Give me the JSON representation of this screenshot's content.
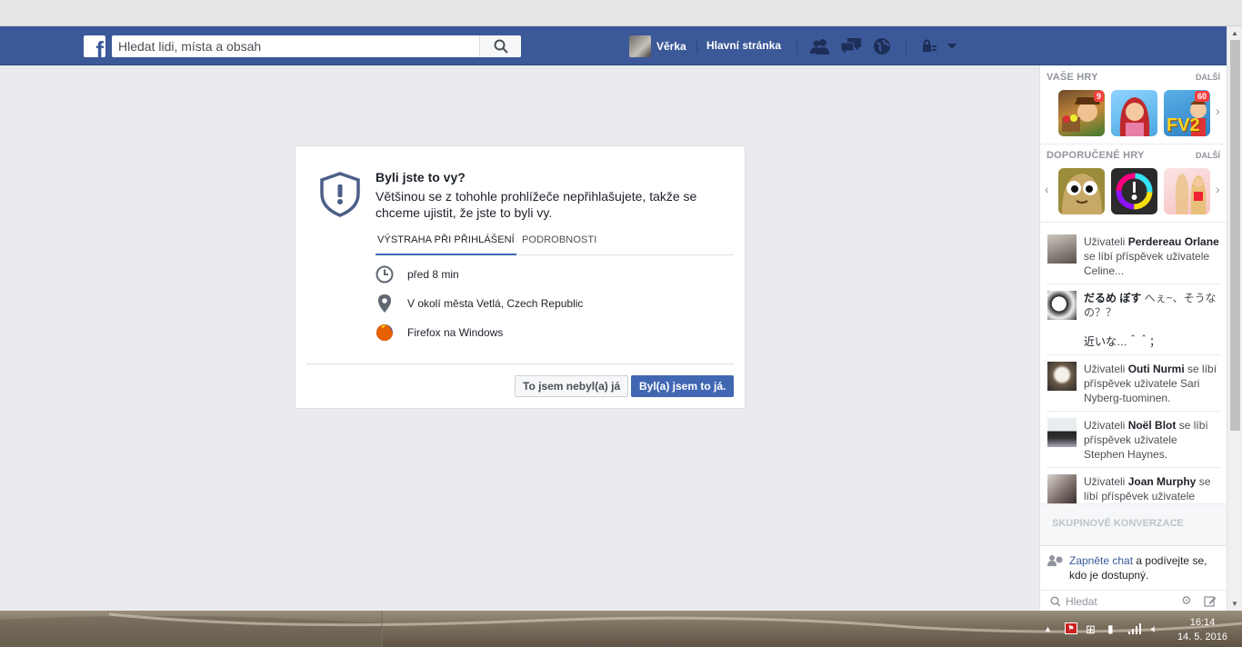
{
  "header": {
    "logo_letter": "f",
    "search_placeholder": "Hledat lidi, místa a obsah",
    "user_name": "Věrka",
    "home_label": "Hlavní stránka",
    "jewels": [
      "friend-requests-icon",
      "messages-icon",
      "notifications-icon",
      "privacy-lock-icon"
    ]
  },
  "alert": {
    "title": "Byli jste to vy?",
    "description": "Většinou se z tohohle prohlížeče nepřihlašujete, takže se chceme ujistit, že jste to byli vy.",
    "tabs": [
      "VÝSTRAHA PŘI PŘIHLÁŠENÍ",
      "PODROBNOSTI"
    ],
    "active_tab": 0,
    "time": "před 8 min",
    "location": "V okolí města Vetlá, Czech Republic",
    "browser": "Firefox na Windows",
    "deny_label": "To jsem nebyl(a) já",
    "confirm_label": "Byl(a) jsem to já.",
    "accent_color": "#4267b2"
  },
  "sidebar": {
    "your_games_title": "VAŠE HRY",
    "recommended_title": "DOPORUČENÉ HRY",
    "more_label": "DALŠÍ",
    "your_games": [
      {
        "badge": "9",
        "name": "game-farmer"
      },
      {
        "badge": "",
        "name": "game-redhead"
      },
      {
        "badge": "60",
        "name": "game-farmville2",
        "text": "FV2"
      }
    ],
    "recommended_games": [
      {
        "name": "game-pou"
      },
      {
        "name": "game-color-switch"
      },
      {
        "name": "game-dressup"
      }
    ],
    "ticker": [
      {
        "prefix": "Uživateli ",
        "name": "Perdereau Orlane",
        "rest": " se líbí příspěvek uživatele Celine..."
      },
      {
        "prefix": "",
        "name": "だるめ ぼす",
        "rest": " へぇ~、そうなの？？",
        "extra": "近いな…＾＾；"
      },
      {
        "prefix": "Uživateli ",
        "name": "Outi Nurmi",
        "rest": " se líbí příspěvek uživatele Sari Nyberg-tuominen."
      },
      {
        "prefix": "Uživateli ",
        "name": "Noël Blot",
        "rest": " se líbí příspěvek uživatele Stephen Haynes."
      },
      {
        "prefix": "Uživateli ",
        "name": "Joan Murphy",
        "rest": " se líbí příspěvek uživatele"
      }
    ],
    "group_chats_title": "SKUPINOVÉ KONVERZACE",
    "chat_link": "Zapněte chat",
    "chat_rest": " a podívejte se, kdo je dostupný.",
    "chat_search_placeholder": "Hledat"
  },
  "taskbar": {
    "time": "16:14",
    "date": "14. 5. 2016"
  }
}
